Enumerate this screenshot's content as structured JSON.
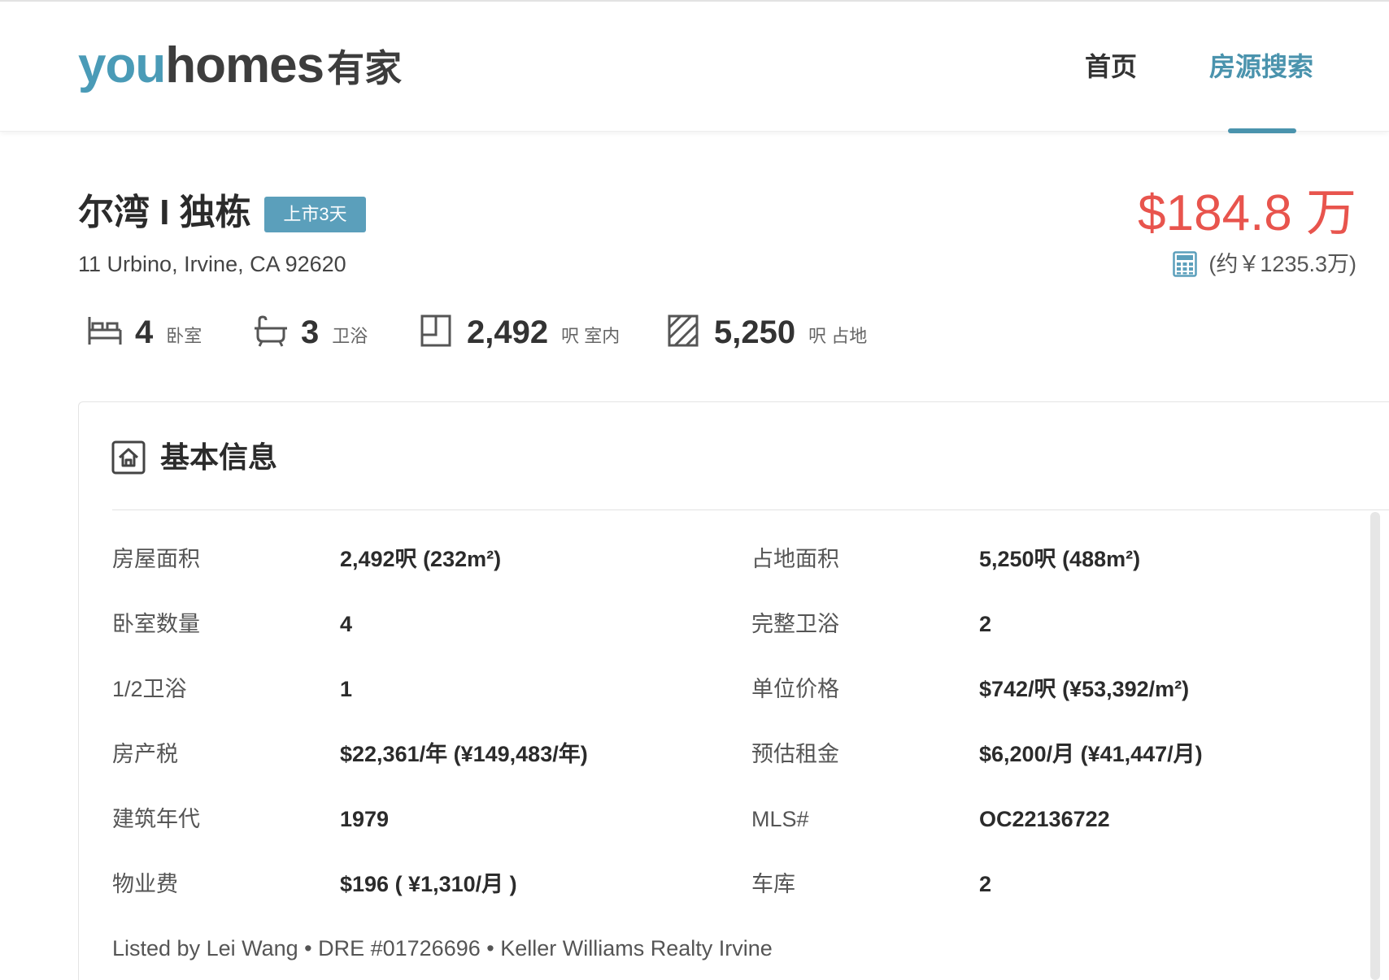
{
  "header": {
    "logo": {
      "you": "you",
      "homes": "homes",
      "cn": "有家"
    },
    "nav": [
      {
        "label": "首页",
        "active": false
      },
      {
        "label": "房源搜索",
        "active": true
      },
      {
        "label": "",
        "active": false
      }
    ]
  },
  "listing": {
    "title": "尔湾 I 独栋",
    "badge": "上市3天",
    "address": "11 Urbino, Irvine, CA 92620",
    "price": "$184.8 万",
    "price_cny": "(约￥1235.3万)"
  },
  "stats": [
    {
      "icon": "bed-icon",
      "value": "4",
      "unit": "卧室"
    },
    {
      "icon": "bathtub-icon",
      "value": "3",
      "unit": "卫浴"
    },
    {
      "icon": "floor-area-icon",
      "value": "2,492",
      "unit": "呎 室内"
    },
    {
      "icon": "lot-area-icon",
      "value": "5,250",
      "unit": "呎 占地"
    }
  ],
  "basic_info": {
    "title": "基本信息",
    "rows": [
      {
        "label1": "房屋面积",
        "value1": "2,492呎 (232m²)",
        "label2": "占地面积",
        "value2": "5,250呎 (488m²)"
      },
      {
        "label1": "卧室数量",
        "value1": "4",
        "label2": "完整卫浴",
        "value2": "2"
      },
      {
        "label1": "1/2卫浴",
        "value1": "1",
        "label2": "单位价格",
        "value2": "$742/呎 (¥53,392/m²)"
      },
      {
        "label1": "房产税",
        "value1": "$22,361/年 (¥149,483/年)",
        "label2": "预估租金",
        "value2": "$6,200/月 (¥41,447/月)"
      },
      {
        "label1": "建筑年代",
        "value1": "1979",
        "label2": "MLS#",
        "value2": "OC22136722"
      },
      {
        "label1": "物业费",
        "value1": "$196 ( ¥1,310/月 )",
        "label2": "车库",
        "value2": "2"
      }
    ],
    "listed_by": "Listed by Lei Wang • DRE #01726696 • Keller Williams Realty Irvine"
  },
  "colors": {
    "brand": "#4a93ad",
    "price": "#e8544d",
    "badge": "#5b9fbb"
  }
}
